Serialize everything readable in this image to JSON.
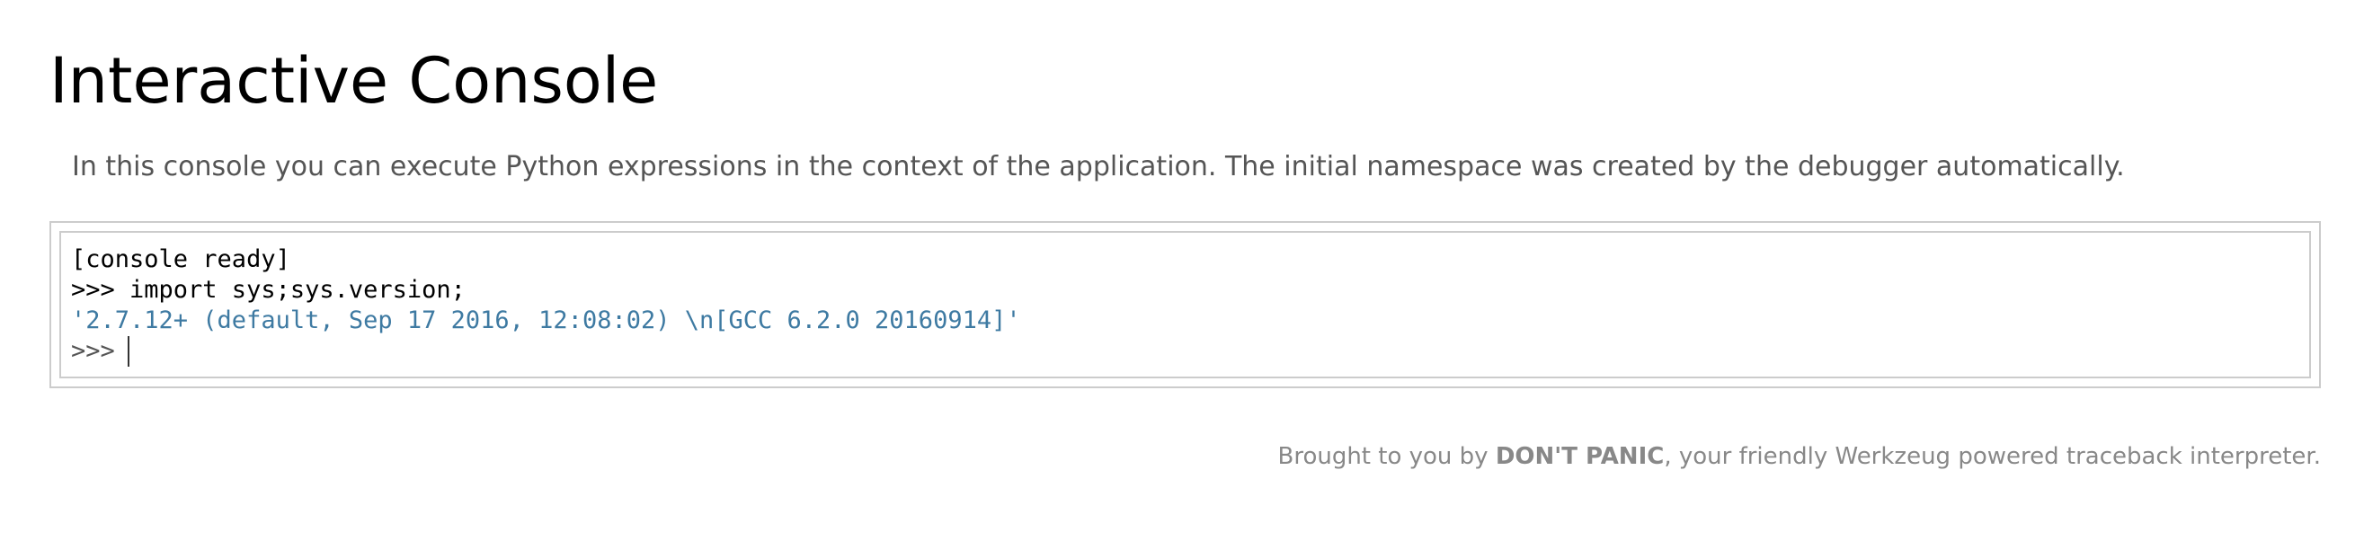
{
  "header": {
    "title": "Interactive Console"
  },
  "explanation": "In this console you can execute Python expressions in the context of the application. The initial namespace was created by the debugger automatically.",
  "console": {
    "lines": [
      {
        "text": "[console ready]",
        "kind": "message"
      },
      {
        "text": ">>> import sys;sys.version;",
        "kind": "input"
      },
      {
        "text": "'2.7.12+ (default, Sep 17 2016, 12:08:02) \\n[GCC 6.2.0 20160914]'",
        "kind": "output"
      }
    ],
    "prompt": ">>>",
    "input_value": "",
    "output_color": "#3e7aa2"
  },
  "footer": {
    "prefix": "Brought to you by ",
    "highlight": "DON'T PANIC",
    "suffix": ", your friendly Werkzeug powered traceback interpreter."
  }
}
